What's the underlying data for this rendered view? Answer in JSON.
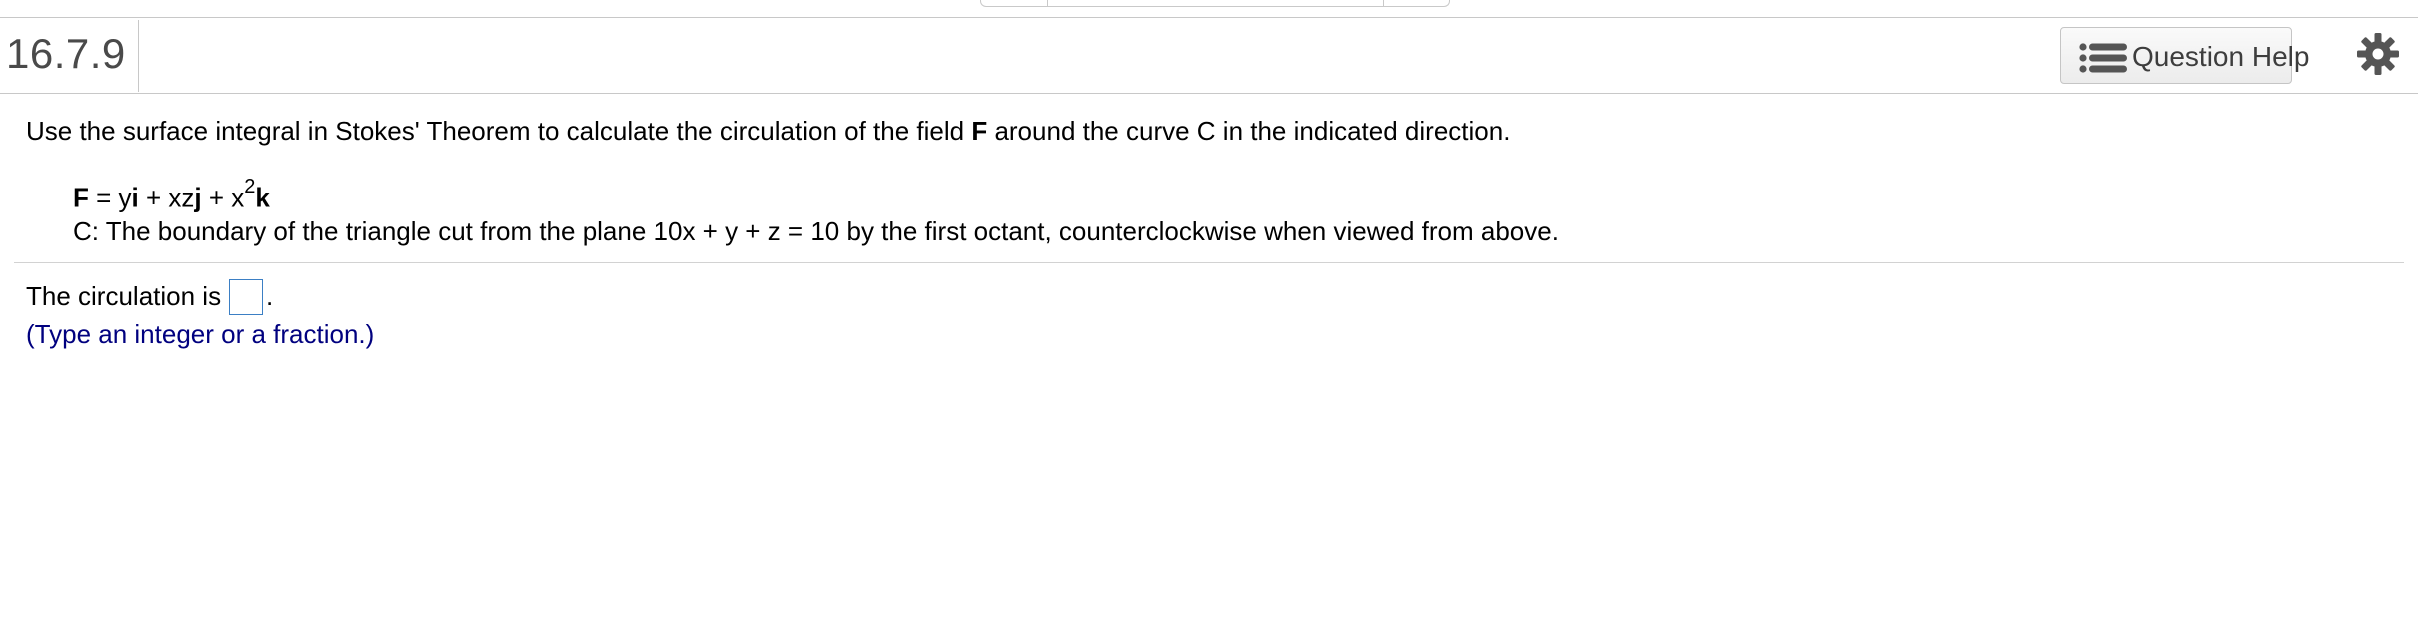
{
  "header": {
    "question_number": "16.7.9",
    "help_button_label": "Question Help",
    "help_icon": "list-icon",
    "settings_icon": "gear-icon"
  },
  "question": {
    "instruction_part1": "Use the surface integral in Stokes' Theorem to calculate the circulation of the field ",
    "instruction_bold": "F",
    "instruction_part2": " around the curve C in the indicated direction.",
    "field_F": "F",
    "field_eq": " = y",
    "field_i": "i",
    "field_plus1": " + xz",
    "field_j": "j",
    "field_plus2": " + x",
    "field_exp": "2",
    "field_k": "k",
    "curve_description": "C: The boundary of the triangle cut from the plane 10x + y + z = 10 by the first octant, counterclockwise when viewed from above."
  },
  "answer": {
    "prompt": "The circulation is",
    "value": "",
    "period": ".",
    "hint": "(Type an integer or a fraction.)"
  },
  "colors": {
    "hint_text": "#00007f",
    "input_border": "#3b7fc4",
    "gear": "#555555"
  }
}
